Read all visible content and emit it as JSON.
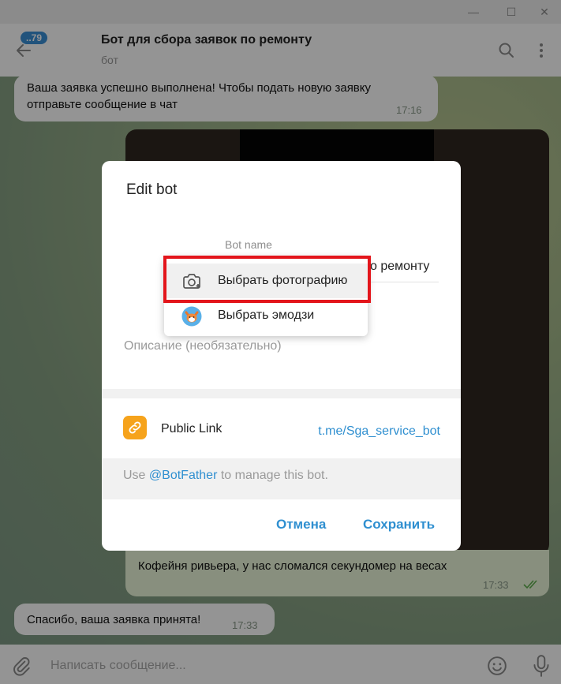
{
  "window": {
    "minimize_glyph": "—",
    "maximize_glyph": "☐",
    "close_glyph": "✕"
  },
  "header": {
    "unread_count": "..79",
    "title": "Бот для сбора заявок по ремонту",
    "subtitle": "бот",
    "icons": [
      "back-arrow-icon",
      "search-icon",
      "more-vertical-icon"
    ]
  },
  "messages": [
    {
      "text_line1": "Ваша заявка успешно выполнена! Чтобы подать новую заявку",
      "text_line2": "отправьте сообщение в чат",
      "time": "17:16"
    },
    {
      "text": "Кофейня ривьера, у нас сломался секундомер на весах",
      "time": "17:33"
    },
    {
      "text": "Спасибо, ваша заявка принята!",
      "time": "17:33"
    }
  ],
  "input": {
    "placeholder": "Написать сообщение...",
    "icons": [
      "attach-icon",
      "emoji-icon",
      "microphone-icon"
    ]
  },
  "dialog": {
    "title": "Edit bot",
    "name_label": "Bot name",
    "name_value_visible": "о ремонту",
    "description_placeholder": "Описание (необязательно)",
    "link_label": "Public Link",
    "link_value": "t.me/Sga_service_bot",
    "hint_prefix": "Use ",
    "hint_mention": "@BotFather",
    "hint_suffix": " to manage this bot.",
    "cancel_label": "Отмена",
    "save_label": "Сохранить"
  },
  "menu": {
    "items": [
      {
        "label": "Выбрать фотографию",
        "icon": "camera-add-icon"
      },
      {
        "label": "Выбрать эмодзи",
        "icon": "emoji-fox-icon"
      }
    ]
  },
  "colors": {
    "accent": "#2f8fd0",
    "link_icon_bg": "#f6a31c",
    "highlight": "#e3151b",
    "read_ticks": "#5fae4e"
  }
}
